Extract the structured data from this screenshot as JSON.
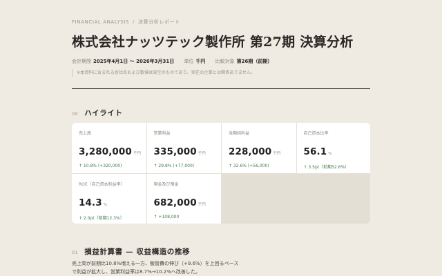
{
  "breadcrumb": {
    "section": "FINANCIAL ANALYSIS",
    "separator": "/",
    "page": "決算分析レポート"
  },
  "title": "株式会社ナッツテック製作所 第27期 決算分析",
  "meta": {
    "period_label": "会計期間",
    "period_value": "2025年4月1日 〜 2026年3月31日",
    "unit_label": "単位",
    "unit_value": "千円",
    "compare_label": "比較対象",
    "compare_value": "第26期（前期）"
  },
  "disclaimer": "※本資料に含まれる会社名および数値は架空のものであり、実在の企業とは関係ありません。",
  "section_highlight": {
    "num": "00",
    "label": "ハイライト"
  },
  "kpis": [
    {
      "label": "売上高",
      "value": "3,280,000",
      "unit": "千円",
      "delta": "↑ 10.8% (+320,000)"
    },
    {
      "label": "営業利益",
      "value": "335,000",
      "unit": "千円",
      "delta": "↑ 29.8% (+77,000)"
    },
    {
      "label": "当期純利益",
      "value": "228,000",
      "unit": "千円",
      "delta": "↑ 32.6% (+56,000)"
    },
    {
      "label": "自己資本比率",
      "value": "56.1",
      "unit": "%",
      "delta": "↑ 3.5pt（前期52.6%）"
    },
    {
      "label": "ROE（自己資本利益率）",
      "value": "14.3",
      "unit": "%",
      "delta": "↑ 2.0pt（前期12.3%）"
    },
    {
      "label": "現金及び預金",
      "value": "682,000",
      "unit": "千円",
      "delta": "↑ +108,000"
    }
  ],
  "section_pl": {
    "num": "01",
    "label": "損益計算書 — 収益構造の推移"
  },
  "pl_text": [
    "売上高が前期比10.8%増える一方、販管費の伸び（+9.6%）を上回るペース",
    "で利益が拡大し、営業利益率は8.7%→10.2%へ改善した。"
  ],
  "colors": {
    "background": "#efebe3",
    "card": "#ffffff",
    "positive": "#3e7a4e",
    "rule": "#3a3632"
  }
}
